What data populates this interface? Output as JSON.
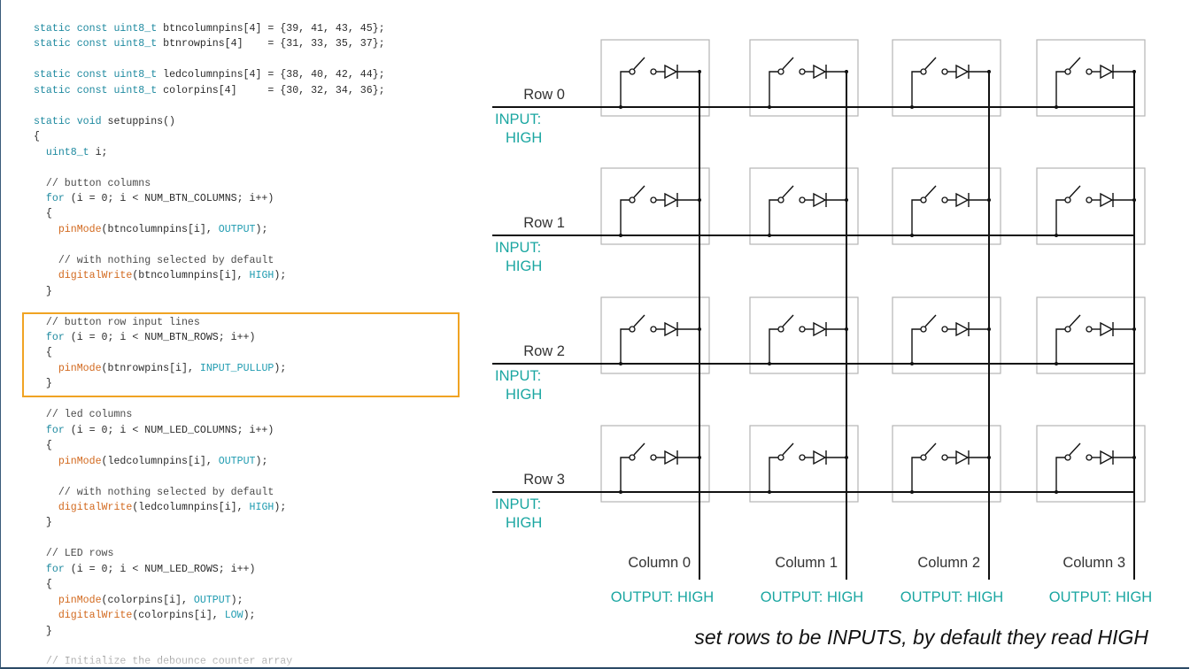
{
  "code": {
    "lines": [
      [
        [
          "tok-kw",
          "static const "
        ],
        [
          "tok-type",
          "uint8_t"
        ],
        [
          "tok-plain",
          " btncolumnpins[4] = {39, 41, 43, 45};"
        ]
      ],
      [
        [
          "tok-kw",
          "static const "
        ],
        [
          "tok-type",
          "uint8_t"
        ],
        [
          "tok-plain",
          " btnrowpins[4]    = {31, 33, 35, 37};"
        ]
      ],
      [],
      [
        [
          "tok-kw",
          "static const "
        ],
        [
          "tok-type",
          "uint8_t"
        ],
        [
          "tok-plain",
          " ledcolumnpins[4] = {38, 40, 42, 44};"
        ]
      ],
      [
        [
          "tok-kw",
          "static const "
        ],
        [
          "tok-type",
          "uint8_t"
        ],
        [
          "tok-plain",
          " colorpins[4]     = {30, 32, 34, 36};"
        ]
      ],
      [],
      [
        [
          "tok-kw",
          "static void"
        ],
        [
          "tok-plain",
          " setuppins()"
        ]
      ],
      [
        [
          "tok-plain",
          "{"
        ]
      ],
      [
        [
          "tok-plain",
          "  "
        ],
        [
          "tok-type",
          "uint8_t"
        ],
        [
          "tok-plain",
          " i;"
        ]
      ],
      [],
      [
        [
          "tok-cmt",
          "  // button columns"
        ]
      ],
      [
        [
          "tok-plain",
          "  "
        ],
        [
          "tok-kw",
          "for"
        ],
        [
          "tok-plain",
          " (i = 0; i < NUM_BTN_COLUMNS; i++)"
        ]
      ],
      [
        [
          "tok-plain",
          "  {"
        ]
      ],
      [
        [
          "tok-plain",
          "    "
        ],
        [
          "tok-fn",
          "pinMode"
        ],
        [
          "tok-plain",
          "(btncolumnpins[i], "
        ],
        [
          "tok-const",
          "OUTPUT"
        ],
        [
          "tok-plain",
          ");"
        ]
      ],
      [],
      [
        [
          "tok-cmt",
          "    // with nothing selected by default"
        ]
      ],
      [
        [
          "tok-plain",
          "    "
        ],
        [
          "tok-fn",
          "digitalWrite"
        ],
        [
          "tok-plain",
          "(btncolumnpins[i], "
        ],
        [
          "tok-const",
          "HIGH"
        ],
        [
          "tok-plain",
          ");"
        ]
      ],
      [
        [
          "tok-plain",
          "  }"
        ]
      ],
      [],
      [
        [
          "tok-cmt",
          "  // button row input lines"
        ]
      ],
      [
        [
          "tok-plain",
          "  "
        ],
        [
          "tok-kw",
          "for"
        ],
        [
          "tok-plain",
          " (i = 0; i < NUM_BTN_ROWS; i++)"
        ]
      ],
      [
        [
          "tok-plain",
          "  {"
        ]
      ],
      [
        [
          "tok-plain",
          "    "
        ],
        [
          "tok-fn",
          "pinMode"
        ],
        [
          "tok-plain",
          "(btnrowpins[i], "
        ],
        [
          "tok-const",
          "INPUT_PULLUP"
        ],
        [
          "tok-plain",
          ");"
        ]
      ],
      [
        [
          "tok-plain",
          "  }"
        ]
      ],
      [],
      [
        [
          "tok-cmt",
          "  // led columns"
        ]
      ],
      [
        [
          "tok-plain",
          "  "
        ],
        [
          "tok-kw",
          "for"
        ],
        [
          "tok-plain",
          " (i = 0; i < NUM_LED_COLUMNS; i++)"
        ]
      ],
      [
        [
          "tok-plain",
          "  {"
        ]
      ],
      [
        [
          "tok-plain",
          "    "
        ],
        [
          "tok-fn",
          "pinMode"
        ],
        [
          "tok-plain",
          "(ledcolumnpins[i], "
        ],
        [
          "tok-const",
          "OUTPUT"
        ],
        [
          "tok-plain",
          ");"
        ]
      ],
      [],
      [
        [
          "tok-cmt",
          "    // with nothing selected by default"
        ]
      ],
      [
        [
          "tok-plain",
          "    "
        ],
        [
          "tok-fn",
          "digitalWrite"
        ],
        [
          "tok-plain",
          "(ledcolumnpins[i], "
        ],
        [
          "tok-const",
          "HIGH"
        ],
        [
          "tok-plain",
          ");"
        ]
      ],
      [
        [
          "tok-plain",
          "  }"
        ]
      ],
      [],
      [
        [
          "tok-cmt",
          "  // LED rows"
        ]
      ],
      [
        [
          "tok-plain",
          "  "
        ],
        [
          "tok-kw",
          "for"
        ],
        [
          "tok-plain",
          " (i = 0; i < NUM_LED_ROWS; i++)"
        ]
      ],
      [
        [
          "tok-plain",
          "  {"
        ]
      ],
      [
        [
          "tok-plain",
          "    "
        ],
        [
          "tok-fn",
          "pinMode"
        ],
        [
          "tok-plain",
          "(colorpins[i], "
        ],
        [
          "tok-const",
          "OUTPUT"
        ],
        [
          "tok-plain",
          ");"
        ]
      ],
      [
        [
          "tok-plain",
          "    "
        ],
        [
          "tok-fn",
          "digitalWrite"
        ],
        [
          "tok-plain",
          "(colorpins[i], "
        ],
        [
          "tok-const",
          "LOW"
        ],
        [
          "tok-plain",
          ");"
        ]
      ],
      [
        [
          "tok-plain",
          "  }"
        ]
      ],
      [],
      [
        [
          "tok-cmt",
          "  // Initialize the debounce counter array"
        ]
      ]
    ],
    "highlighted_comment": "// button row input lines"
  },
  "diagram": {
    "rows": [
      {
        "label": "Row 0",
        "io_line1": "INPUT:",
        "io_line2": "HIGH"
      },
      {
        "label": "Row 1",
        "io_line1": "INPUT:",
        "io_line2": "HIGH"
      },
      {
        "label": "Row 2",
        "io_line1": "INPUT:",
        "io_line2": "HIGH"
      },
      {
        "label": "Row 3",
        "io_line1": "INPUT:",
        "io_line2": "HIGH"
      }
    ],
    "columns": [
      {
        "label": "Column 0",
        "io": "OUTPUT: HIGH"
      },
      {
        "label": "Column 1",
        "io": "OUTPUT: HIGH"
      },
      {
        "label": "Column 2",
        "io": "OUTPUT: HIGH"
      },
      {
        "label": "Column 3",
        "io": "OUTPUT: HIGH"
      }
    ],
    "caption": "set rows to be INPUTS, by default they read HIGH"
  },
  "colors": {
    "wire": "#111111",
    "cell_border": "#b5b5b5",
    "io_label": "#1aa6a1",
    "highlight": "#f0a323",
    "code_keyword": "#1f8aa0",
    "code_function": "#d2691e"
  },
  "icons": [
    "switch-diode-icon"
  ]
}
